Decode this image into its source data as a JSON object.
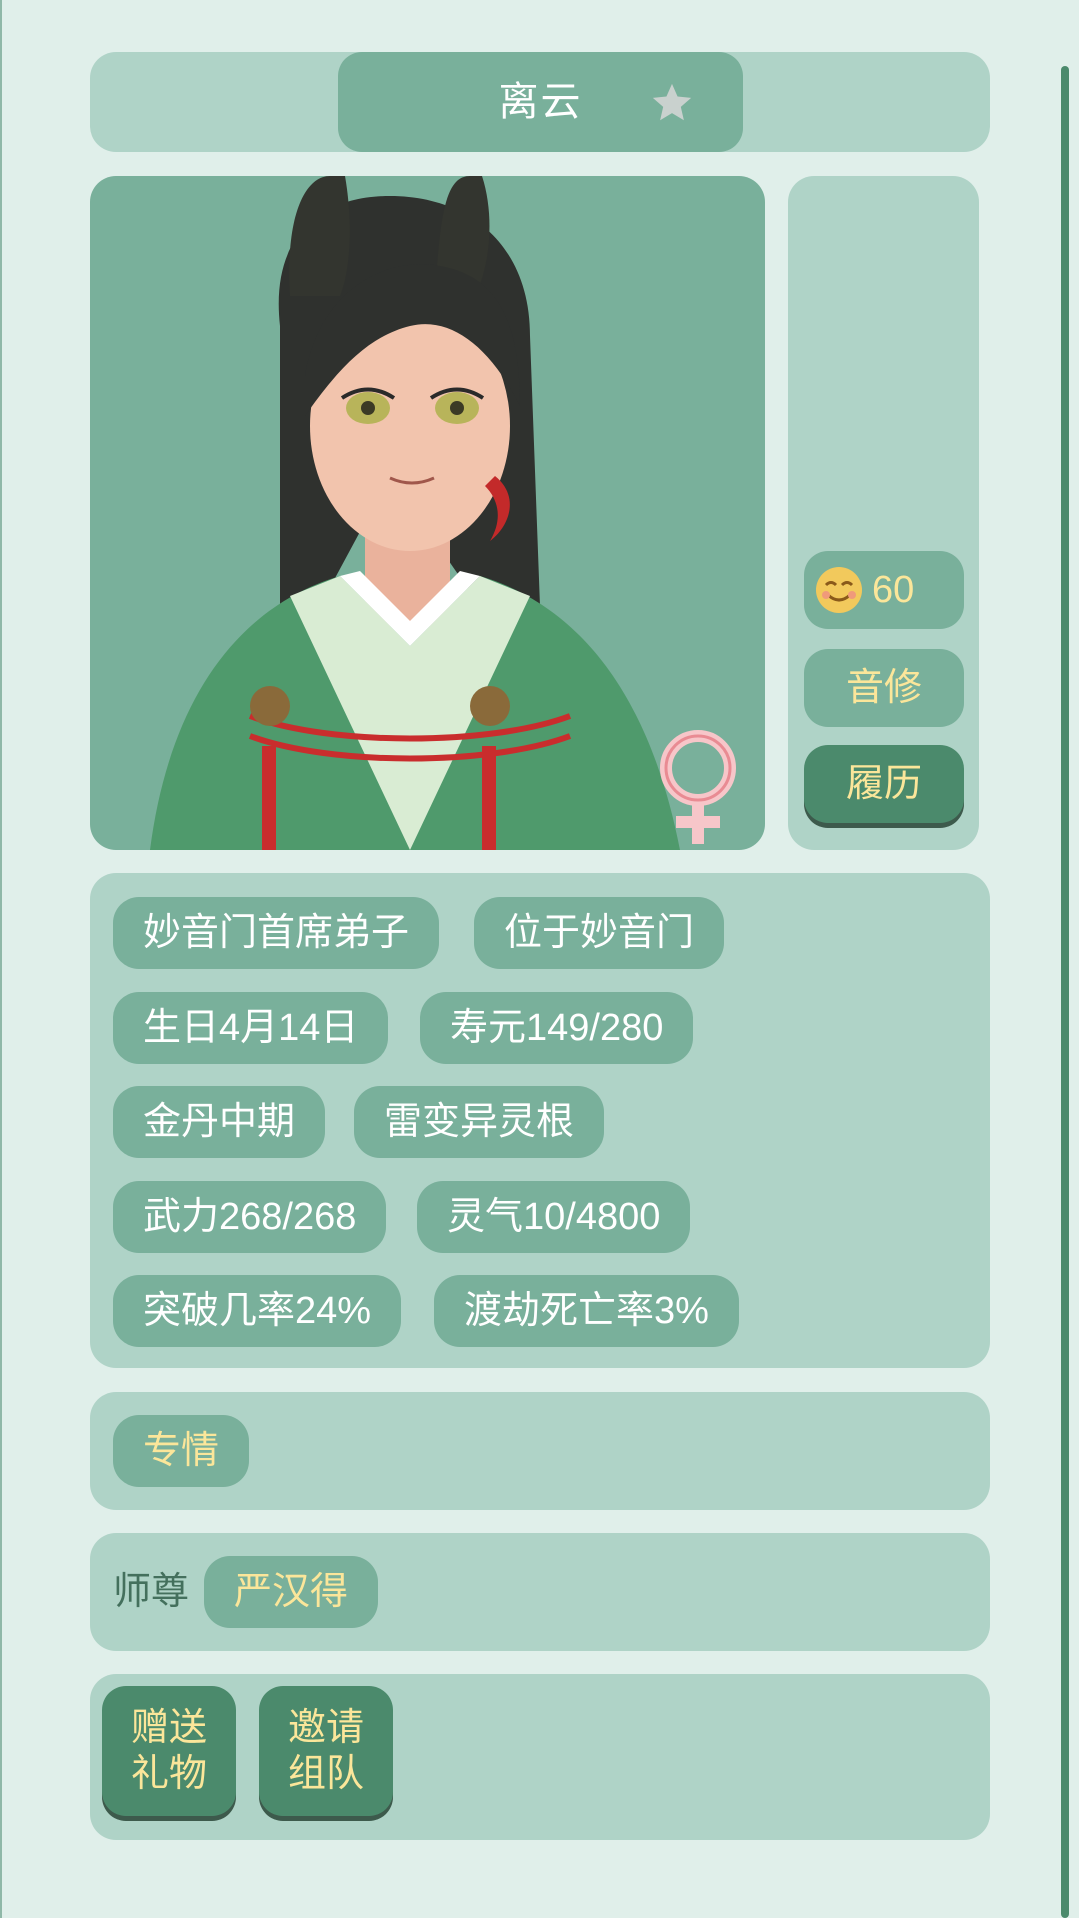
{
  "header": {
    "name": "离云"
  },
  "side": {
    "mood_value": "60",
    "school": "音修",
    "resume": "履历"
  },
  "tags": [
    "妙音门首席弟子",
    "位于妙音门",
    "生日4月14日",
    "寿元149/280",
    "金丹中期",
    "雷变异灵根",
    "武力268/268",
    "灵气10/4800",
    "突破几率24%",
    "渡劫死亡率3%"
  ],
  "traits": [
    "专情"
  ],
  "master": {
    "label": "师尊",
    "name": "严汉得"
  },
  "actions": {
    "gift": {
      "line1": "赠送",
      "line2": "礼物"
    },
    "invite": {
      "line1": "邀请",
      "line2": "组队"
    }
  },
  "icons": {
    "favorite": "star-icon",
    "gender": "female-symbol-icon",
    "mood": "smiling-face-icon"
  },
  "colors": {
    "accent_text": "#fbe69a",
    "panel": "#afd3c7",
    "pill": "#79b09b",
    "button": "#4b8a6c"
  }
}
